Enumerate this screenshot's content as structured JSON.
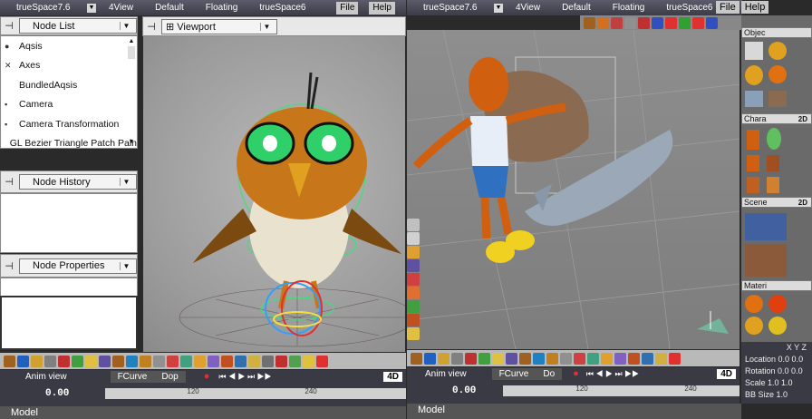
{
  "left_window": {
    "title": "trueSpace7.6",
    "tabs": [
      "4View",
      "Default",
      "Floating",
      "trueSpace6"
    ],
    "menu": [
      "File",
      "Help"
    ]
  },
  "right_window": {
    "title": "trueSpace7.6",
    "tabs": [
      "4View",
      "Default",
      "Floating",
      "trueSpace6"
    ],
    "menu": [
      "File",
      "Help"
    ]
  },
  "node_list": {
    "header": "Node List",
    "items": [
      {
        "label": "Aqsis",
        "icon": "aqsis-icon"
      },
      {
        "label": "Axes",
        "icon": "axes-icon"
      },
      {
        "label": "BundledAqsis",
        "icon": ""
      },
      {
        "label": "Camera",
        "icon": "camera-icon"
      },
      {
        "label": "Camera Transformation",
        "icon": "camera-icon"
      },
      {
        "label": "GL Bezier Triangle Patch Pain",
        "icon": ""
      }
    ]
  },
  "node_history": {
    "header": "Node History"
  },
  "node_properties": {
    "header": "Node Properties"
  },
  "viewport": {
    "header": "Viewport"
  },
  "anim_left": {
    "tabs": [
      "Anim view",
      "FCurve",
      "Dop"
    ],
    "time": "0.00",
    "mode": "4D",
    "ticks": [
      "120",
      "240"
    ]
  },
  "anim_right": {
    "tabs": [
      "Anim view",
      "FCurve",
      "Do"
    ],
    "time": "0.00",
    "mode": "4D",
    "ticks": [
      "120",
      "240"
    ]
  },
  "status": {
    "left": "Model",
    "right": "Model"
  },
  "right_panels": {
    "objects": "Objec",
    "characters": "Chara",
    "scenes": "Scene",
    "materials": "Materi",
    "badge": "2D"
  },
  "properties": {
    "axes": [
      "X",
      "Y",
      "Z"
    ],
    "rows": [
      {
        "label": "Location",
        "value": "0.0 0.0"
      },
      {
        "label": "Rotation",
        "value": "0.0 0.0"
      },
      {
        "label": "Scale",
        "value": "1.0 1.0"
      },
      {
        "label": "BB Size",
        "value": "1.0"
      }
    ]
  },
  "colors": {
    "title_bg": "#45454f",
    "viewport_gray": "#9a9a9a",
    "accent_orange": "#e07a10",
    "bird_green": "#3ee07a"
  }
}
